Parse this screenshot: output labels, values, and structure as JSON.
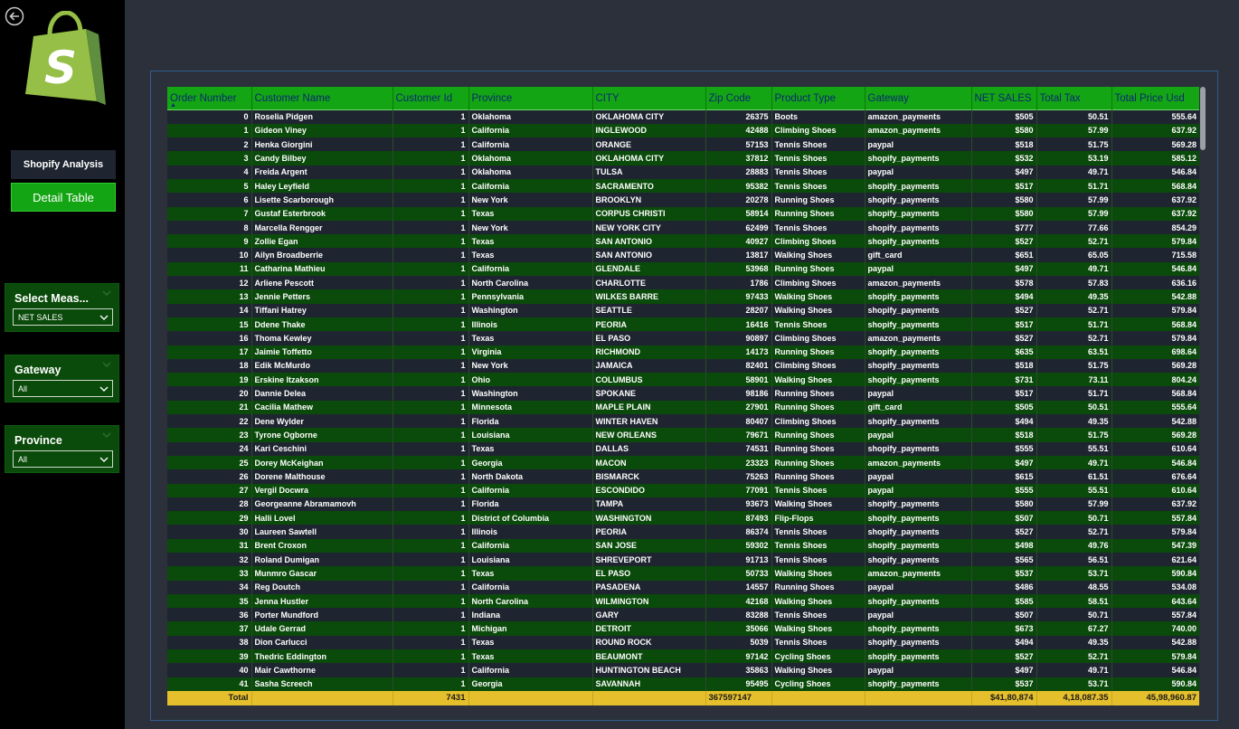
{
  "nav": {
    "analysis_label": "Shopify Analysis",
    "detail_label": "Detail Table"
  },
  "slicers": {
    "measure": {
      "title": "Select Meas...",
      "value": "NET SALES"
    },
    "gateway": {
      "title": "Gateway",
      "value": "All"
    },
    "province": {
      "title": "Province",
      "value": "All"
    }
  },
  "table": {
    "columns": [
      "Order Number",
      "Customer Name",
      "Customer Id",
      "Province",
      "CITY",
      "Zip Code",
      "Product Type",
      "Gateway",
      "NET SALES",
      "Total Tax",
      "Total Price Usd"
    ],
    "sort_indicator": "▲",
    "rows": [
      [
        "0",
        "Roselia Pidgen",
        "1",
        "Oklahoma",
        "OKLAHOMA CITY",
        "26375",
        "Boots",
        "amazon_payments",
        "$505",
        "50.51",
        "555.64"
      ],
      [
        "1",
        "Gideon Viney",
        "1",
        "California",
        "INGLEWOOD",
        "42488",
        "Climbing Shoes",
        "amazon_payments",
        "$580",
        "57.99",
        "637.92"
      ],
      [
        "2",
        "Henka Giorgini",
        "1",
        "California",
        "ORANGE",
        "57153",
        "Tennis Shoes",
        "paypal",
        "$518",
        "51.75",
        "569.28"
      ],
      [
        "3",
        "Candy Bilbey",
        "1",
        "Oklahoma",
        "OKLAHOMA CITY",
        "37812",
        "Tennis Shoes",
        "shopify_payments",
        "$532",
        "53.19",
        "585.12"
      ],
      [
        "4",
        "Freida Argent",
        "1",
        "Oklahoma",
        "TULSA",
        "28883",
        "Tennis Shoes",
        "paypal",
        "$497",
        "49.71",
        "546.84"
      ],
      [
        "5",
        "Haley Leyfield",
        "1",
        "California",
        "SACRAMENTO",
        "95382",
        "Tennis Shoes",
        "shopify_payments",
        "$517",
        "51.71",
        "568.84"
      ],
      [
        "6",
        "Lisette Scarborough",
        "1",
        "New York",
        "BROOKLYN",
        "20278",
        "Running Shoes",
        "shopify_payments",
        "$580",
        "57.99",
        "637.92"
      ],
      [
        "7",
        "Gustaf Esterbrook",
        "1",
        "Texas",
        "CORPUS CHRISTI",
        "58914",
        "Running Shoes",
        "shopify_payments",
        "$580",
        "57.99",
        "637.92"
      ],
      [
        "8",
        "Marcella Rengger",
        "1",
        "New York",
        "NEW YORK CITY",
        "62499",
        "Tennis Shoes",
        "shopify_payments",
        "$777",
        "77.66",
        "854.29"
      ],
      [
        "9",
        "Zollie Egan",
        "1",
        "Texas",
        "SAN ANTONIO",
        "40927",
        "Climbing Shoes",
        "shopify_payments",
        "$527",
        "52.71",
        "579.84"
      ],
      [
        "10",
        "Ailyn Broadberrie",
        "1",
        "Texas",
        "SAN ANTONIO",
        "13817",
        "Walking Shoes",
        "gift_card",
        "$651",
        "65.05",
        "715.58"
      ],
      [
        "11",
        "Catharina Mathieu",
        "1",
        "California",
        "GLENDALE",
        "53968",
        "Running Shoes",
        "paypal",
        "$497",
        "49.71",
        "546.84"
      ],
      [
        "12",
        "Arliene Pescott",
        "1",
        "North Carolina",
        "CHARLOTTE",
        "1786",
        "Climbing Shoes",
        "amazon_payments",
        "$578",
        "57.83",
        "636.16"
      ],
      [
        "13",
        "Jennie Petters",
        "1",
        "Pennsylvania",
        "WILKES BARRE",
        "97433",
        "Walking Shoes",
        "shopify_payments",
        "$494",
        "49.35",
        "542.88"
      ],
      [
        "14",
        "Tiffani Hatrey",
        "1",
        "Washington",
        "SEATTLE",
        "28207",
        "Walking Shoes",
        "shopify_payments",
        "$527",
        "52.71",
        "579.84"
      ],
      [
        "15",
        "Ddene Thake",
        "1",
        "Illinois",
        "PEORIA",
        "16416",
        "Tennis Shoes",
        "shopify_payments",
        "$517",
        "51.71",
        "568.84"
      ],
      [
        "16",
        "Thoma Kewley",
        "1",
        "Texas",
        "EL PASO",
        "90897",
        "Climbing Shoes",
        "amazon_payments",
        "$527",
        "52.71",
        "579.84"
      ],
      [
        "17",
        "Jaimie Toffetto",
        "1",
        "Virginia",
        "RICHMOND",
        "14173",
        "Running Shoes",
        "shopify_payments",
        "$635",
        "63.51",
        "698.64"
      ],
      [
        "18",
        "Edik McMurdo",
        "1",
        "New York",
        "JAMAICA",
        "82401",
        "Climbing Shoes",
        "shopify_payments",
        "$518",
        "51.75",
        "569.28"
      ],
      [
        "19",
        "Erskine Itzakson",
        "1",
        "Ohio",
        "COLUMBUS",
        "58901",
        "Walking Shoes",
        "shopify_payments",
        "$731",
        "73.11",
        "804.24"
      ],
      [
        "20",
        "Dannie Delea",
        "1",
        "Washington",
        "SPOKANE",
        "98186",
        "Running Shoes",
        "paypal",
        "$517",
        "51.71",
        "568.84"
      ],
      [
        "21",
        "Cacilia Mathew",
        "1",
        "Minnesota",
        "MAPLE PLAIN",
        "27901",
        "Running Shoes",
        "gift_card",
        "$505",
        "50.51",
        "555.64"
      ],
      [
        "22",
        "Dene Wylder",
        "1",
        "Florida",
        "WINTER HAVEN",
        "80407",
        "Climbing Shoes",
        "shopify_payments",
        "$494",
        "49.35",
        "542.88"
      ],
      [
        "23",
        "Tyrone Ogborne",
        "1",
        "Louisiana",
        "NEW ORLEANS",
        "79671",
        "Running Shoes",
        "paypal",
        "$518",
        "51.75",
        "569.28"
      ],
      [
        "24",
        "Kari Ceschini",
        "1",
        "Texas",
        "DALLAS",
        "74531",
        "Running Shoes",
        "shopify_payments",
        "$555",
        "55.51",
        "610.64"
      ],
      [
        "25",
        "Dorey McKeighan",
        "1",
        "Georgia",
        "MACON",
        "23323",
        "Running Shoes",
        "amazon_payments",
        "$497",
        "49.71",
        "546.84"
      ],
      [
        "26",
        "Dorene Malthouse",
        "1",
        "North Dakota",
        "BISMARCK",
        "75263",
        "Running Shoes",
        "paypal",
        "$615",
        "61.51",
        "676.64"
      ],
      [
        "27",
        "Vergil Docwra",
        "1",
        "California",
        "ESCONDIDO",
        "77091",
        "Tennis Shoes",
        "paypal",
        "$555",
        "55.51",
        "610.64"
      ],
      [
        "28",
        "Georgeanne Abramamovh",
        "1",
        "Florida",
        "TAMPA",
        "93673",
        "Walking Shoes",
        "shopify_payments",
        "$580",
        "57.99",
        "637.92"
      ],
      [
        "29",
        "Halli Lovel",
        "1",
        "District of Columbia",
        "WASHINGTON",
        "87493",
        "Flip-Flops",
        "shopify_payments",
        "$507",
        "50.71",
        "557.84"
      ],
      [
        "30",
        "Laureen Sawtell",
        "1",
        "Illinois",
        "PEORIA",
        "86374",
        "Tennis Shoes",
        "shopify_payments",
        "$527",
        "52.71",
        "579.84"
      ],
      [
        "31",
        "Brent Croxon",
        "1",
        "California",
        "SAN JOSE",
        "59302",
        "Tennis Shoes",
        "shopify_payments",
        "$498",
        "49.76",
        "547.39"
      ],
      [
        "32",
        "Roland Dumigan",
        "1",
        "Louisiana",
        "SHREVEPORT",
        "91713",
        "Tennis Shoes",
        "shopify_payments",
        "$565",
        "56.51",
        "621.64"
      ],
      [
        "33",
        "Munmro Gascar",
        "1",
        "Texas",
        "EL PASO",
        "50733",
        "Walking Shoes",
        "amazon_payments",
        "$537",
        "53.71",
        "590.84"
      ],
      [
        "34",
        "Reg Doutch",
        "1",
        "California",
        "PASADENA",
        "14557",
        "Running Shoes",
        "paypal",
        "$486",
        "48.55",
        "534.08"
      ],
      [
        "35",
        "Jenna Hustler",
        "1",
        "North Carolina",
        "WILMINGTON",
        "42168",
        "Walking Shoes",
        "shopify_payments",
        "$585",
        "58.51",
        "643.64"
      ],
      [
        "36",
        "Porter Mundford",
        "1",
        "Indiana",
        "GARY",
        "83288",
        "Tennis Shoes",
        "paypal",
        "$507",
        "50.71",
        "557.84"
      ],
      [
        "37",
        "Udale Gerrad",
        "1",
        "Michigan",
        "DETROIT",
        "35066",
        "Walking Shoes",
        "shopify_payments",
        "$673",
        "67.27",
        "740.00"
      ],
      [
        "38",
        "Dion Carlucci",
        "1",
        "Texas",
        "ROUND ROCK",
        "5039",
        "Tennis Shoes",
        "shopify_payments",
        "$494",
        "49.35",
        "542.88"
      ],
      [
        "39",
        "Thedric Eddington",
        "1",
        "Texas",
        "BEAUMONT",
        "97142",
        "Cycling Shoes",
        "shopify_payments",
        "$527",
        "52.71",
        "579.84"
      ],
      [
        "40",
        "Mair Cawthorne",
        "1",
        "California",
        "HUNTINGTON BEACH",
        "35863",
        "Walking Shoes",
        "paypal",
        "$497",
        "49.71",
        "546.84"
      ],
      [
        "41",
        "Sasha Screech",
        "1",
        "Georgia",
        "SAVANNAH",
        "95495",
        "Cycling Shoes",
        "shopify_payments",
        "$537",
        "53.71",
        "590.84"
      ]
    ],
    "total": [
      "Total",
      "",
      "7431",
      "",
      "",
      "367597147",
      "",
      "",
      "$41,80,874",
      "4,18,087.35",
      "45,98,960.87"
    ]
  },
  "colors": {
    "brand_green": "#14a514",
    "header_text": "#0a2a70",
    "row_dark": "#1f2530",
    "row_green": "#0a4a0a",
    "total_bg": "#e6c02c",
    "background": "#2b303a"
  },
  "icons": {
    "back": "back-arrow-circle-icon",
    "logo": "shopify-bag-logo",
    "dropdown": "chevron-down-icon"
  }
}
